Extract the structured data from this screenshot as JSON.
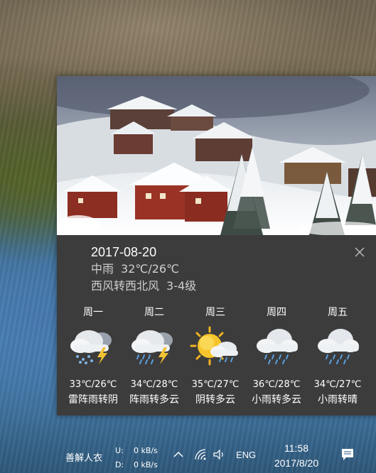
{
  "weather": {
    "current": {
      "date": "2017-08-20",
      "condition": "中雨",
      "temp_range": "32℃/26℃",
      "wind": "西风转西北风",
      "wind_level": "3-4级"
    },
    "forecast": [
      {
        "day": "周一",
        "temp": "33℃/26℃",
        "desc": "雷阵雨转阴",
        "icon": "thunder-rain-snow-icon"
      },
      {
        "day": "周二",
        "temp": "34℃/28℃",
        "desc": "阵雨转多云",
        "icon": "thunder-rain-icon"
      },
      {
        "day": "周三",
        "temp": "35℃/27℃",
        "desc": "阴转多云",
        "icon": "sun-cloud-rain-icon"
      },
      {
        "day": "周四",
        "temp": "36℃/28℃",
        "desc": "小雨转多云",
        "icon": "cloud-rain-icon"
      },
      {
        "day": "周五",
        "temp": "34℃/27℃",
        "desc": "小雨转晴",
        "icon": "cloud-rain-icon"
      }
    ]
  },
  "taskbar": {
    "app_label": "善解人衣",
    "upload_label": "U:",
    "upload_value": "0 kB/s",
    "download_label": "D:",
    "download_value": "0 kB/s",
    "language": "ENG",
    "time": "11:58",
    "date": "2017/8/20"
  },
  "colors": {
    "panel_bg": "#3c3c3c",
    "text_primary": "#ffffff",
    "text_secondary": "#cfcfcf"
  }
}
